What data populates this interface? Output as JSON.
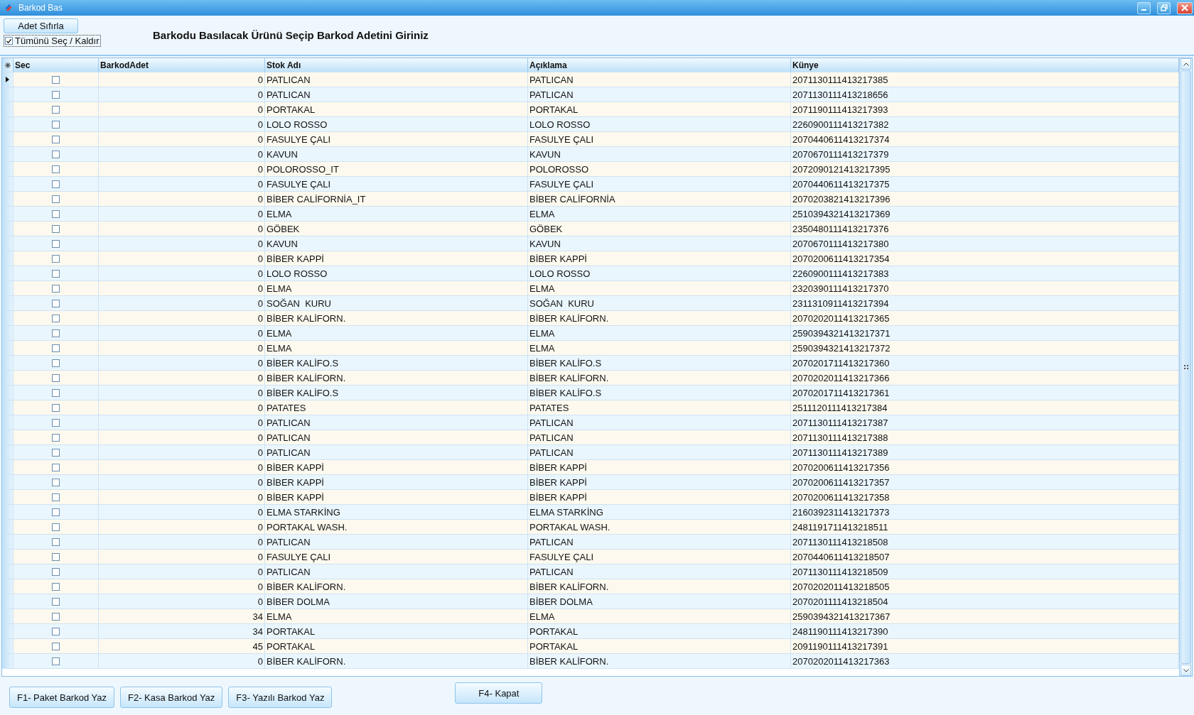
{
  "window": {
    "title": "Barkod Bas"
  },
  "toolbar": {
    "reset_button": "Adet Sıfırla",
    "select_all": {
      "label": "Tümünü Seç / Kaldır",
      "checked": true
    },
    "heading": "Barkodu Basılacak Ürünü Seçip Barkod Adetini Giriniz"
  },
  "table": {
    "columns": [
      "Sec",
      "BarkodAdet",
      "Stok Adı",
      "Açıklama",
      "Künye"
    ],
    "rows": [
      {
        "selected": true,
        "checked": false,
        "barkod_adet": "0",
        "stok_adi": "PATLICAN",
        "aciklama": "PATLICAN",
        "kunye": "2071130111413217385"
      },
      {
        "selected": false,
        "checked": false,
        "barkod_adet": "0",
        "stok_adi": "PATLICAN",
        "aciklama": "PATLICAN",
        "kunye": "2071130111413218656"
      },
      {
        "selected": false,
        "checked": false,
        "barkod_adet": "0",
        "stok_adi": "PORTAKAL",
        "aciklama": "PORTAKAL",
        "kunye": "2071190111413217393"
      },
      {
        "selected": false,
        "checked": false,
        "barkod_adet": "0",
        "stok_adi": "LOLO ROSSO",
        "aciklama": "LOLO ROSSO",
        "kunye": "2260900111413217382"
      },
      {
        "selected": false,
        "checked": false,
        "barkod_adet": "0",
        "stok_adi": "FASULYE ÇALI",
        "aciklama": "FASULYE ÇALI",
        "kunye": "2070440611413217374"
      },
      {
        "selected": false,
        "checked": false,
        "barkod_adet": "0",
        "stok_adi": "KAVUN",
        "aciklama": "KAVUN",
        "kunye": "2070670111413217379"
      },
      {
        "selected": false,
        "checked": false,
        "barkod_adet": "0",
        "stok_adi": "POLOROSSO_IT",
        "aciklama": "POLOROSSO",
        "kunye": "2072090121413217395"
      },
      {
        "selected": false,
        "checked": false,
        "barkod_adet": "0",
        "stok_adi": "FASULYE ÇALI",
        "aciklama": "FASULYE ÇALI",
        "kunye": "2070440611413217375"
      },
      {
        "selected": false,
        "checked": false,
        "barkod_adet": "0",
        "stok_adi": "BİBER CALİFORNİA_IT",
        "aciklama": "BİBER CALİFORNİA",
        "kunye": "2070203821413217396"
      },
      {
        "selected": false,
        "checked": false,
        "barkod_adet": "0",
        "stok_adi": "ELMA",
        "aciklama": "ELMA",
        "kunye": "2510394321413217369"
      },
      {
        "selected": false,
        "checked": false,
        "barkod_adet": "0",
        "stok_adi": "GÖBEK",
        "aciklama": "GÖBEK",
        "kunye": "2350480111413217376"
      },
      {
        "selected": false,
        "checked": false,
        "barkod_adet": "0",
        "stok_adi": "KAVUN",
        "aciklama": "KAVUN",
        "kunye": "2070670111413217380"
      },
      {
        "selected": false,
        "checked": false,
        "barkod_adet": "0",
        "stok_adi": "BİBER KAPPİ",
        "aciklama": "BİBER KAPPİ",
        "kunye": "2070200611413217354"
      },
      {
        "selected": false,
        "checked": false,
        "barkod_adet": "0",
        "stok_adi": "LOLO ROSSO",
        "aciklama": "LOLO ROSSO",
        "kunye": "2260900111413217383"
      },
      {
        "selected": false,
        "checked": false,
        "barkod_adet": "0",
        "stok_adi": "ELMA",
        "aciklama": "ELMA",
        "kunye": "2320390111413217370"
      },
      {
        "selected": false,
        "checked": false,
        "barkod_adet": "0",
        "stok_adi": "SOĞAN  KURU",
        "aciklama": "SOĞAN  KURU",
        "kunye": "2311310911413217394"
      },
      {
        "selected": false,
        "checked": false,
        "barkod_adet": "0",
        "stok_adi": "BİBER KALİFORN.",
        "aciklama": "BİBER KALİFORN.",
        "kunye": "2070202011413217365"
      },
      {
        "selected": false,
        "checked": false,
        "barkod_adet": "0",
        "stok_adi": "ELMA",
        "aciklama": "ELMA",
        "kunye": "2590394321413217371"
      },
      {
        "selected": false,
        "checked": false,
        "barkod_adet": "0",
        "stok_adi": "ELMA",
        "aciklama": "ELMA",
        "kunye": "2590394321413217372"
      },
      {
        "selected": false,
        "checked": false,
        "barkod_adet": "0",
        "stok_adi": "BİBER KALİFO.S",
        "aciklama": "BİBER KALİFO.S",
        "kunye": "2070201711413217360"
      },
      {
        "selected": false,
        "checked": false,
        "barkod_adet": "0",
        "stok_adi": "BİBER KALİFORN.",
        "aciklama": "BİBER KALİFORN.",
        "kunye": "2070202011413217366"
      },
      {
        "selected": false,
        "checked": false,
        "barkod_adet": "0",
        "stok_adi": "BİBER KALİFO.S",
        "aciklama": "BİBER KALİFO.S",
        "kunye": "2070201711413217361"
      },
      {
        "selected": false,
        "checked": false,
        "barkod_adet": "0",
        "stok_adi": "PATATES",
        "aciklama": "PATATES",
        "kunye": "2511120111413217384"
      },
      {
        "selected": false,
        "checked": false,
        "barkod_adet": "0",
        "stok_adi": "PATLICAN",
        "aciklama": "PATLICAN",
        "kunye": "2071130111413217387"
      },
      {
        "selected": false,
        "checked": false,
        "barkod_adet": "0",
        "stok_adi": "PATLICAN",
        "aciklama": "PATLICAN",
        "kunye": "2071130111413217388"
      },
      {
        "selected": false,
        "checked": false,
        "barkod_adet": "0",
        "stok_adi": "PATLICAN",
        "aciklama": "PATLICAN",
        "kunye": "2071130111413217389"
      },
      {
        "selected": false,
        "checked": false,
        "barkod_adet": "0",
        "stok_adi": "BİBER KAPPİ",
        "aciklama": "BİBER KAPPİ",
        "kunye": "2070200611413217356"
      },
      {
        "selected": false,
        "checked": false,
        "barkod_adet": "0",
        "stok_adi": "BİBER KAPPİ",
        "aciklama": "BİBER KAPPİ",
        "kunye": "2070200611413217357"
      },
      {
        "selected": false,
        "checked": false,
        "barkod_adet": "0",
        "stok_adi": "BİBER KAPPİ",
        "aciklama": "BİBER KAPPİ",
        "kunye": "2070200611413217358"
      },
      {
        "selected": false,
        "checked": false,
        "barkod_adet": "0",
        "stok_adi": "ELMA STARKİNG",
        "aciklama": "ELMA STARKİNG",
        "kunye": "2160392311413217373"
      },
      {
        "selected": false,
        "checked": false,
        "barkod_adet": "0",
        "stok_adi": "PORTAKAL WASH.",
        "aciklama": "PORTAKAL WASH.",
        "kunye": "2481191711413218511"
      },
      {
        "selected": false,
        "checked": false,
        "barkod_adet": "0",
        "stok_adi": "PATLICAN",
        "aciklama": "PATLICAN",
        "kunye": "2071130111413218508"
      },
      {
        "selected": false,
        "checked": false,
        "barkod_adet": "0",
        "stok_adi": "FASULYE ÇALI",
        "aciklama": "FASULYE ÇALI",
        "kunye": "2070440611413218507"
      },
      {
        "selected": false,
        "checked": false,
        "barkod_adet": "0",
        "stok_adi": "PATLICAN",
        "aciklama": "PATLICAN",
        "kunye": "2071130111413218509"
      },
      {
        "selected": false,
        "checked": false,
        "barkod_adet": "0",
        "stok_adi": "BİBER KALİFORN.",
        "aciklama": "BİBER KALİFORN.",
        "kunye": "2070202011413218505"
      },
      {
        "selected": false,
        "checked": false,
        "barkod_adet": "0",
        "stok_adi": "BİBER DOLMA",
        "aciklama": "BİBER DOLMA",
        "kunye": "2070201111413218504"
      },
      {
        "selected": false,
        "checked": false,
        "barkod_adet": "34",
        "stok_adi": "ELMA",
        "aciklama": "ELMA",
        "kunye": "2590394321413217367"
      },
      {
        "selected": false,
        "checked": false,
        "barkod_adet": "34",
        "stok_adi": "PORTAKAL",
        "aciklama": "PORTAKAL",
        "kunye": "2481190111413217390"
      },
      {
        "selected": false,
        "checked": false,
        "barkod_adet": "45",
        "stok_adi": "PORTAKAL",
        "aciklama": "PORTAKAL",
        "kunye": "2091190111413217391"
      },
      {
        "selected": false,
        "checked": false,
        "barkod_adet": "0",
        "stok_adi": "BİBER KALİFORN.",
        "aciklama": "BİBER KALİFORN.",
        "kunye": "2070202011413217363"
      }
    ]
  },
  "buttons": [
    "F1- Paket Barkod Yaz",
    "F2- Kasa Barkod Yaz",
    "F3- Yazılı Barkod Yaz"
  ],
  "close_button": "F4- Kapat"
}
